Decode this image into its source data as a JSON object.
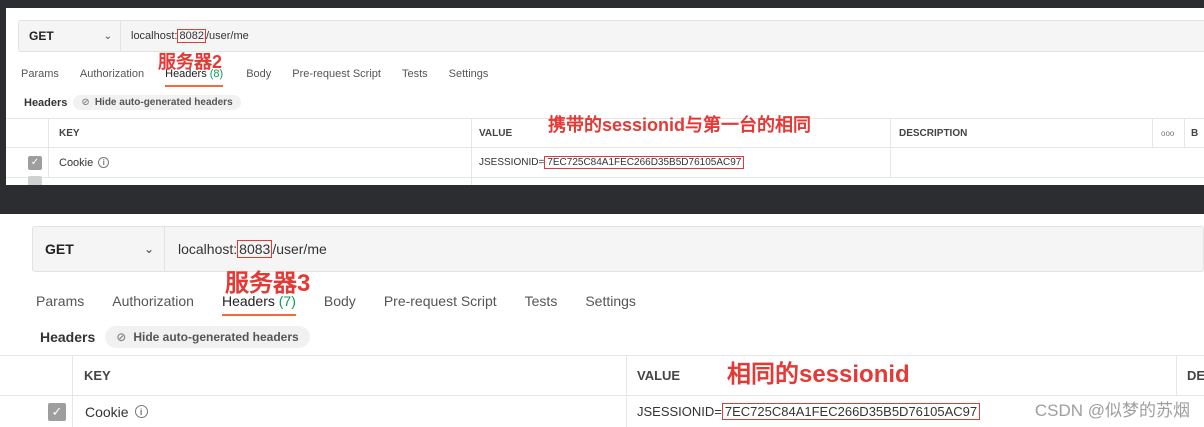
{
  "panel1": {
    "method": "GET",
    "url_prefix": "localhost:",
    "url_port": "8082",
    "url_suffix": "/user/me",
    "annot_server": "服务器2",
    "tabs": [
      {
        "label": "Params"
      },
      {
        "label": "Authorization"
      },
      {
        "label": "Headers",
        "count": "(8)"
      },
      {
        "label": "Body"
      },
      {
        "label": "Pre-request Script"
      },
      {
        "label": "Tests"
      },
      {
        "label": "Settings"
      }
    ],
    "headers_label": "Headers",
    "hide_label": "Hide auto-generated headers",
    "columns": {
      "key": "KEY",
      "value": "VALUE",
      "description": "DESCRIPTION",
      "more": "ooo",
      "bulk": "B"
    },
    "annot_value": "携带的sessionid与第一台的相同",
    "row": {
      "key": "Cookie",
      "value_prefix": "JSESSIONID=",
      "value_id": "7EC725C84A1FEC266D35B5D76105AC97"
    }
  },
  "panel2": {
    "method": "GET",
    "url_prefix": "localhost:",
    "url_port": "8083",
    "url_suffix": "/user/me",
    "annot_server": "服务器3",
    "tabs": [
      {
        "label": "Params"
      },
      {
        "label": "Authorization"
      },
      {
        "label": "Headers",
        "count": "(7)"
      },
      {
        "label": "Body"
      },
      {
        "label": "Pre-request Script"
      },
      {
        "label": "Tests"
      },
      {
        "label": "Settings"
      }
    ],
    "headers_label": "Headers",
    "hide_label": "Hide auto-generated headers",
    "columns": {
      "key": "KEY",
      "value": "VALUE",
      "description": "DE"
    },
    "annot_value": "相同的sessionid",
    "row": {
      "key": "Cookie",
      "value_prefix": "JSESSIONID=",
      "value_id": "7EC725C84A1FEC266D35B5D76105AC97"
    }
  },
  "watermark": "CSDN @似梦的苏烟",
  "colors": {
    "annotation": "#e53935",
    "tab_underline": "#f26b3a",
    "count_green": "#0c9b5a"
  }
}
